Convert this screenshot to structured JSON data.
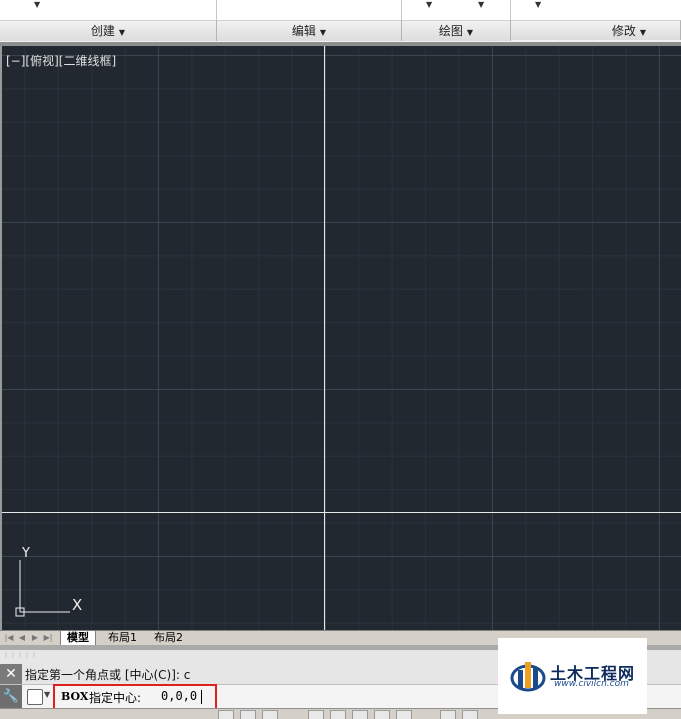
{
  "ribbon": {
    "panels": [
      {
        "label": "创建"
      },
      {
        "label": "编辑"
      },
      {
        "label": "绘图"
      },
      {
        "label": "修改"
      }
    ]
  },
  "viewport": {
    "label": "[−][俯视][二维线框]",
    "ucs": {
      "x_label": "X",
      "y_label": "Y"
    }
  },
  "tabs": {
    "model": "模型",
    "layout1": "布局1",
    "layout2": "布局2"
  },
  "command": {
    "history_line": "指定第一个角点或 [中心(C)]: c",
    "command_name": "BOX",
    "prompt": "指定中心:",
    "value": "0,0,0"
  },
  "logo": {
    "title": "土木工程网",
    "url": "www.civilcn.com",
    "colors": {
      "primary": "#0f2a5c",
      "accent": "#f0a020"
    }
  },
  "colors": {
    "viewport_bg": "#212830",
    "highlight_box": "#e0201e"
  }
}
